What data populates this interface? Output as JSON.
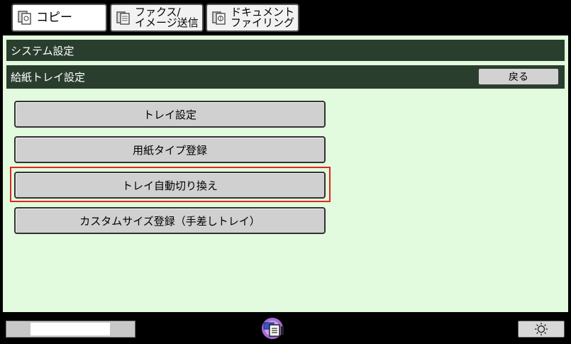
{
  "tabs": {
    "copy": {
      "label": "コピー"
    },
    "fax": {
      "line1": "ファクス/",
      "line2": "イメージ送信"
    },
    "doc": {
      "line1": "ドキュメント",
      "line2": "ファイリング"
    }
  },
  "header": {
    "system_settings": "システム設定",
    "tray_settings": "給紙トレイ設定",
    "back_label": "戻る"
  },
  "menu": {
    "items": [
      {
        "label": "トレイ設定"
      },
      {
        "label": "用紙タイプ登録"
      },
      {
        "label": "トレイ自動切り換え"
      },
      {
        "label": "カスタムサイズ登録（手差しトレイ）"
      }
    ],
    "highlighted_index": 2
  },
  "colors": {
    "panel_bg": "#e2fadd",
    "header_bar": "#2a3e2e",
    "highlight": "#e0261b"
  },
  "icons": {
    "copy": "copy-icon",
    "fax": "fax-icon",
    "doc": "document-filing-icon",
    "job_status": "job-status-icon",
    "brightness": "brightness-icon"
  }
}
